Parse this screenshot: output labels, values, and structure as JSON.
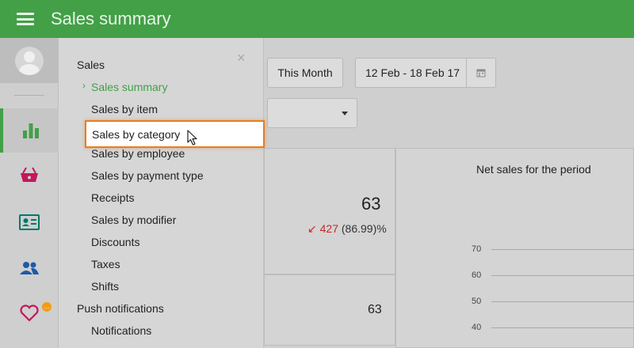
{
  "app": {
    "title": "Sales summary"
  },
  "toolbar": {
    "period_button": "This Month",
    "date_range": "12 Feb - 18 Feb 17"
  },
  "summary": {
    "gross_value": "63",
    "change_amount": "427",
    "change_percent": "(86.99)%",
    "second_value": "63"
  },
  "chart": {
    "title": "Net sales for the period",
    "y_ticks": [
      "70",
      "60",
      "50",
      "40"
    ]
  },
  "drawer": {
    "close_symbol": "×",
    "items": [
      {
        "label": "Sales"
      },
      {
        "label": "Sales summary"
      },
      {
        "label": "Sales by item"
      },
      {
        "label": "Sales by category"
      },
      {
        "label": "Sales by employee"
      },
      {
        "label": "Sales by payment type"
      },
      {
        "label": "Receipts"
      },
      {
        "label": "Sales by modifier"
      },
      {
        "label": "Discounts"
      },
      {
        "label": "Taxes"
      },
      {
        "label": "Shifts"
      },
      {
        "label": "Push notifications"
      },
      {
        "label": "Notifications"
      }
    ]
  },
  "rail": {
    "icons": [
      "reports-icon",
      "basket-icon",
      "employee-card-icon",
      "customers-icon",
      "loyalty-heart-icon"
    ],
    "badge": "…"
  },
  "colors": {
    "primary": "#43a047",
    "highlight_border": "#e67e22",
    "negative": "#c62828"
  }
}
